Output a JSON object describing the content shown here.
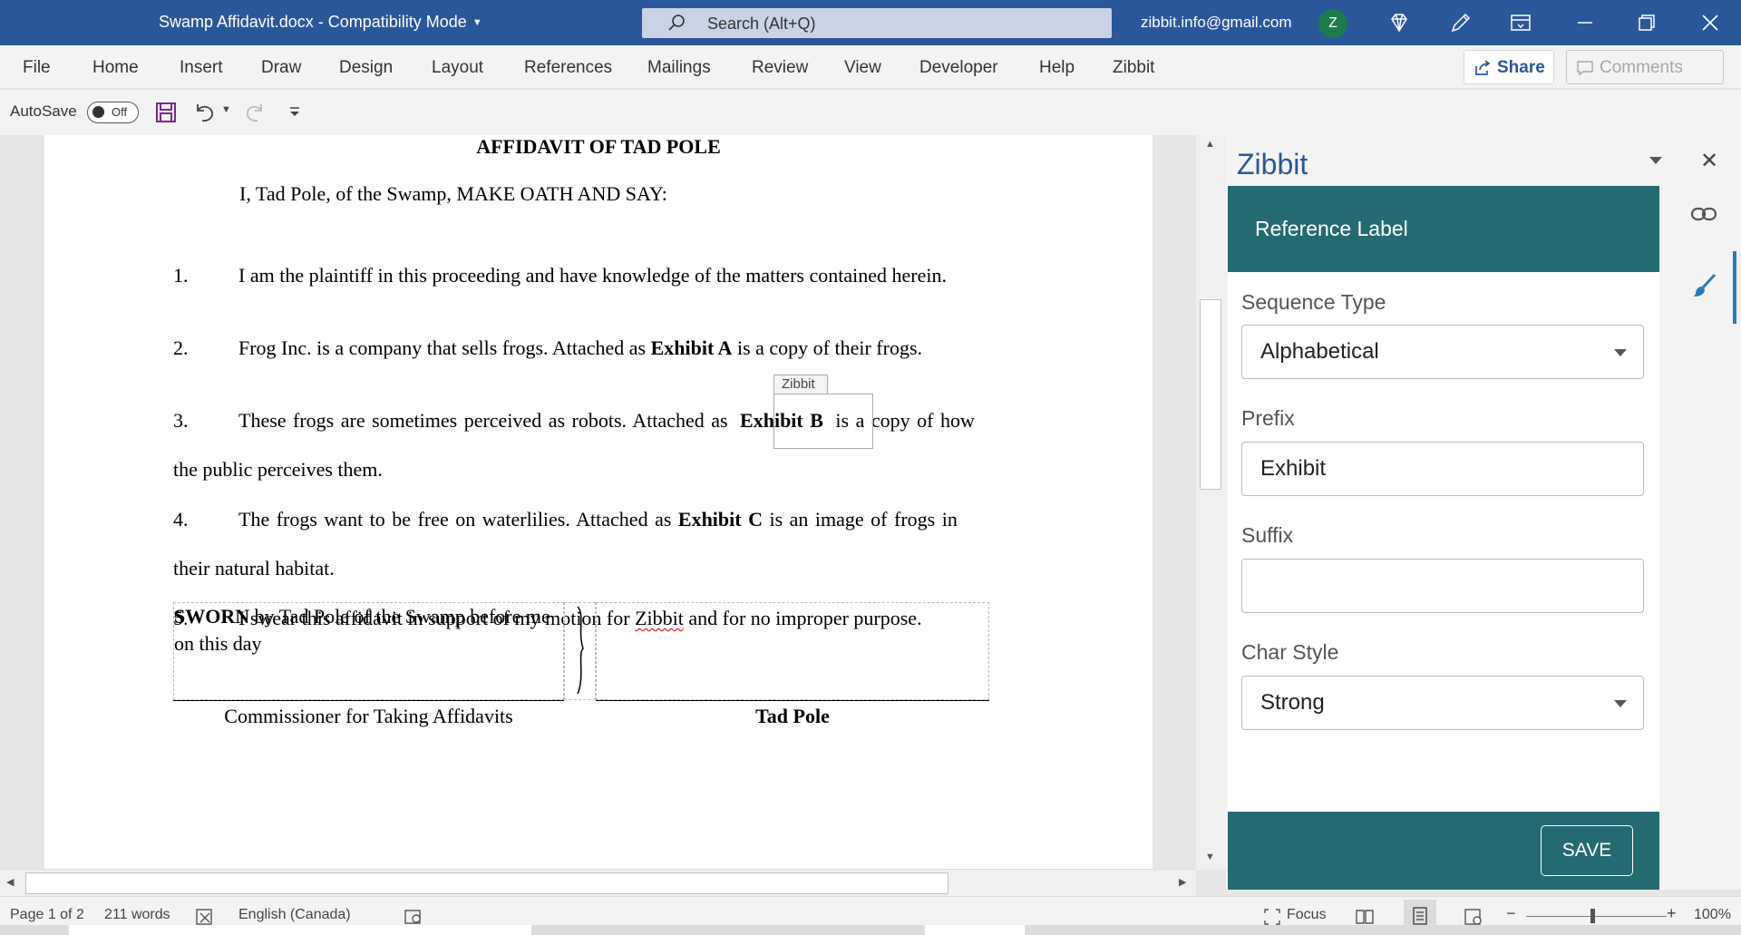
{
  "window": {
    "doc_title": "Swamp Affidavit.docx  -  Compatibility Mode",
    "search_placeholder": "Search (Alt+Q)",
    "account_email": "zibbit.info@gmail.com",
    "avatar_initial": "Z"
  },
  "ribbon": {
    "tabs": [
      "File",
      "Home",
      "Insert",
      "Draw",
      "Design",
      "Layout",
      "References",
      "Mailings",
      "Review",
      "View",
      "Developer",
      "Help",
      "Zibbit"
    ],
    "share_label": "Share",
    "comments_label": "Comments"
  },
  "qat": {
    "autosave_label": "AutoSave",
    "autosave_state": "Off"
  },
  "document": {
    "heading": "AFFIDAVIT OF TAD POLE",
    "intro": "I, Tad Pole, of the Swamp, MAKE OATH AND SAY:",
    "paragraphs": [
      {
        "num": "1.",
        "text": "I am the plaintiff in this proceeding and have knowledge of the matters contained herein."
      },
      {
        "num": "2.",
        "pre": "Frog Inc. is a company that sells frogs. Attached as ",
        "bold": "Exhibit A",
        "post": " is a copy of their frogs."
      },
      {
        "num": "3.",
        "pre": "These frogs are sometimes perceived as robots. Attached as ",
        "bold": "Exhibit B",
        "post": " is a copy of how",
        "line2": "the public perceives them."
      },
      {
        "num": "4.",
        "pre": "The frogs want to be free on waterlilies. Attached as ",
        "bold": "Exhibit C",
        "post": " is an image of frogs in",
        "line2": "their natural habitat."
      },
      {
        "num": "5.",
        "pre": "I swear this affidavit in support of my motion for ",
        "squiggle": "Zibbit",
        "post": " and for no improper purpose."
      }
    ],
    "content_control_tag": "Zibbit",
    "sworn_bold": "SWORN",
    "sworn_rest": " by Tad Pole of the Swamp before me on this day",
    "commissioner": "Commissioner for Taking Affidavits",
    "deponent": "Tad Pole"
  },
  "pane": {
    "title": "Zibbit",
    "header": "Reference Label",
    "fields": {
      "sequence_type_label": "Sequence Type",
      "sequence_type_value": "Alphabetical",
      "prefix_label": "Prefix",
      "prefix_value": "Exhibit",
      "suffix_label": "Suffix",
      "suffix_value": "",
      "char_style_label": "Char Style",
      "char_style_value": "Strong"
    },
    "save_label": "SAVE",
    "accent_color": "#256a70"
  },
  "status": {
    "page": "Page 1 of 2",
    "words": "211 words",
    "language": "English (Canada)",
    "focus": "Focus",
    "zoom": "100%"
  }
}
